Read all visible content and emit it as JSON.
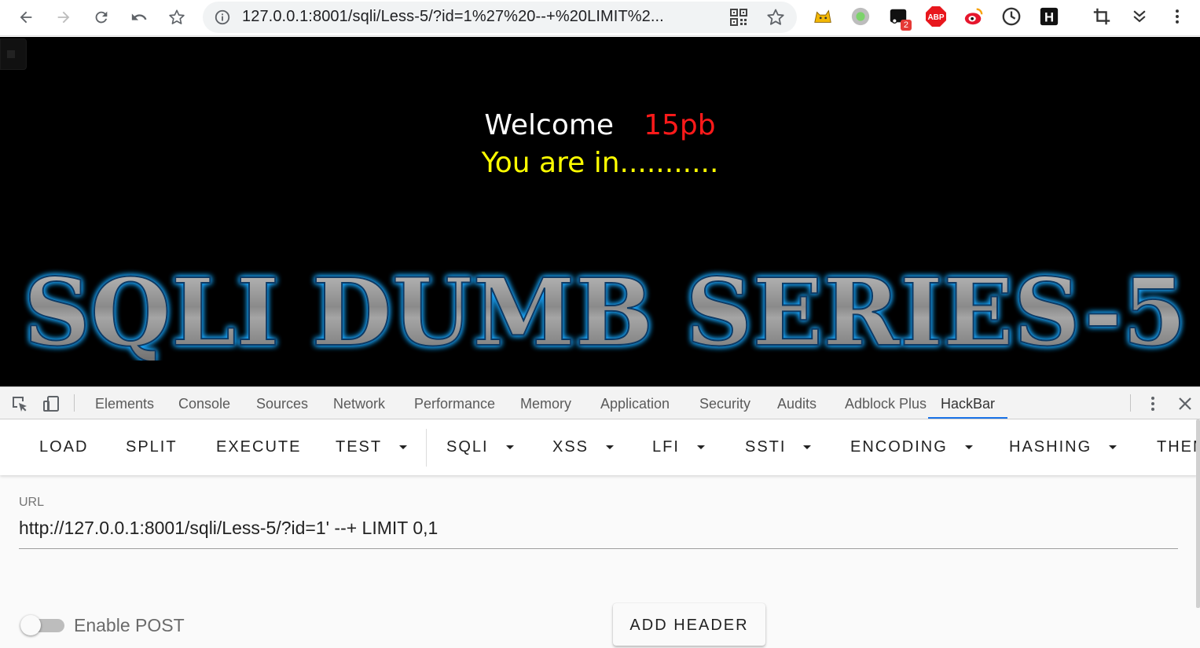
{
  "browser": {
    "address_bar": {
      "url_display": "127.0.0.1:8001/sqli/Less-5/?id=1%27%20--+%20LIMIT%2..."
    },
    "extensions": [
      {
        "name": "tampermonkey-cat-icon"
      },
      {
        "name": "green-dot-extension-icon"
      },
      {
        "name": "extension-with-badge-icon",
        "badge": "2"
      },
      {
        "name": "adblock-plus-icon",
        "label": "ABP"
      },
      {
        "name": "weibo-icon"
      },
      {
        "name": "clock-icon"
      },
      {
        "name": "hackbar-h-icon",
        "label": "H"
      },
      {
        "name": "crop-icon"
      },
      {
        "name": "chevron-double-down-icon"
      },
      {
        "name": "kebab-menu-icon"
      }
    ]
  },
  "page": {
    "welcome_text": "Welcome",
    "welcome_user": "15pb",
    "you_are_in": "You are in...........",
    "banner_text": "SQLI DUMB SERIES-5",
    "colors": {
      "background": "#000000",
      "welcome": "#ffffff",
      "user": "#ff1a1a",
      "status": "#ffff00",
      "banner_glow": "#1ea8ff"
    }
  },
  "devtools": {
    "tabs": [
      "Elements",
      "Console",
      "Sources",
      "Network",
      "Performance",
      "Memory",
      "Application",
      "Security",
      "Audits",
      "Adblock Plus",
      "HackBar"
    ],
    "active_tab": "HackBar",
    "hackbar": {
      "menu": [
        {
          "label": "LOAD",
          "dropdown": false
        },
        {
          "label": "SPLIT",
          "dropdown": false
        },
        {
          "label": "EXECUTE",
          "dropdown": false
        },
        {
          "label": "TEST",
          "dropdown": true
        },
        {
          "label": "SQLI",
          "dropdown": true
        },
        {
          "label": "XSS",
          "dropdown": true
        },
        {
          "label": "LFI",
          "dropdown": true
        },
        {
          "label": "SSTI",
          "dropdown": true
        },
        {
          "label": "ENCODING",
          "dropdown": true
        },
        {
          "label": "HASHING",
          "dropdown": true
        },
        {
          "label": "THEME",
          "dropdown": true
        }
      ],
      "url_label": "URL",
      "url_value": "http://127.0.0.1:8001/sqli/Less-5/?id=1' --+ LIMIT 0,1",
      "enable_post_label": "Enable POST",
      "enable_post": false,
      "add_header_label": "ADD HEADER"
    }
  }
}
